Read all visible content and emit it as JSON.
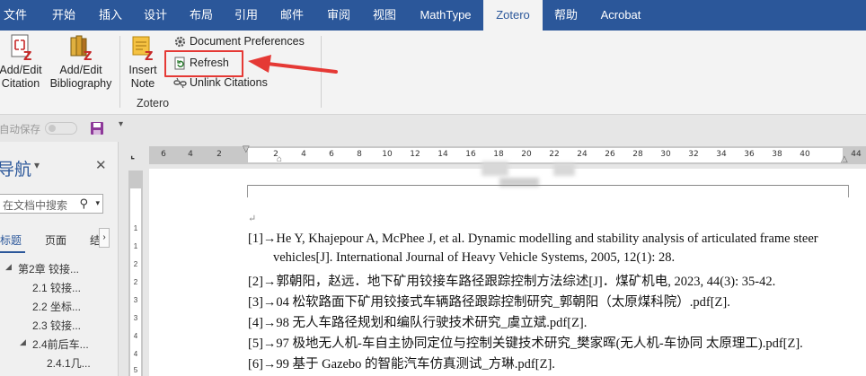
{
  "tabs": [
    {
      "label": "文件"
    },
    {
      "label": "开始"
    },
    {
      "label": "插入"
    },
    {
      "label": "设计"
    },
    {
      "label": "布局"
    },
    {
      "label": "引用"
    },
    {
      "label": "邮件"
    },
    {
      "label": "审阅"
    },
    {
      "label": "视图"
    },
    {
      "label": "MathType"
    },
    {
      "label": "Zotero"
    },
    {
      "label": "帮助"
    },
    {
      "label": "Acrobat"
    }
  ],
  "active_tab": "Zotero",
  "ribbon": {
    "add_edit_citation": {
      "line1": "Add/Edit",
      "line2": "Citation"
    },
    "add_edit_bibliography": {
      "line1": "Add/Edit",
      "line2": "Bibliography"
    },
    "insert_note": {
      "line1": "Insert",
      "line2": "Note"
    },
    "document_preferences": "Document Preferences",
    "refresh": "Refresh",
    "unlink_citations": "Unlink Citations",
    "group_label": "Zotero"
  },
  "qat": {
    "autosave_label": "自动保存",
    "toggle_state": "off"
  },
  "nav": {
    "title": "导航",
    "search_placeholder": "在文档中搜索",
    "tabs": [
      {
        "label": "标题"
      },
      {
        "label": "页面"
      },
      {
        "label": "结"
      }
    ],
    "items": [
      {
        "label": "第2章 铰接..."
      },
      {
        "label": "2.1 铰接..."
      },
      {
        "label": "2.2 坐标..."
      },
      {
        "label": "2.3 铰接..."
      },
      {
        "label": "2.4前后车..."
      },
      {
        "label": "2.4.1几..."
      }
    ]
  },
  "ruler": {
    "left_ticks": [
      "6",
      "4",
      "2"
    ],
    "right_ticks": [
      "2",
      "4",
      "6",
      "8",
      "10",
      "12",
      "14",
      "16",
      "18",
      "20",
      "22",
      "24",
      "26",
      "28",
      "30",
      "32",
      "34",
      "36",
      "38",
      "40",
      "44"
    ],
    "v_ticks": [
      "1",
      "1",
      "2",
      "2",
      "3",
      "3",
      "4",
      "4",
      "5"
    ]
  },
  "document": {
    "references": [
      {
        "line1": "[1]→He Y, Khajepour A, McPhee J, et al. Dynamic modelling and stability analysis of articulated frame steer",
        "line2": "vehicles[J]. International Journal of Heavy Vehicle Systems, 2005, 12(1): 28."
      },
      {
        "line1": "[2]→郭朝阳，赵远．地下矿用铰接车路径跟踪控制方法综述[J]．煤矿机电, 2023, 44(3): 35-42."
      },
      {
        "line1": "[3]→04 松软路面下矿用铰接式车辆路径跟踪控制研究_郭朝阳（太原煤科院）.pdf[Z]."
      },
      {
        "line1": "[4]→98 无人车路径规划和编队行驶技术研究_虞立斌.pdf[Z]."
      },
      {
        "line1": "[5]→97 极地无人机-车自主协同定位与控制关键技术研究_樊家晖(无人机-车协同 太原理工).pdf[Z]."
      },
      {
        "line1": "[6]→99 基于 Gazebo 的智能汽车仿真测试_方琳.pdf[Z]."
      }
    ],
    "paragraph_mark": "↵"
  },
  "colors": {
    "accent": "#2b579a",
    "highlight": "#e53935"
  }
}
